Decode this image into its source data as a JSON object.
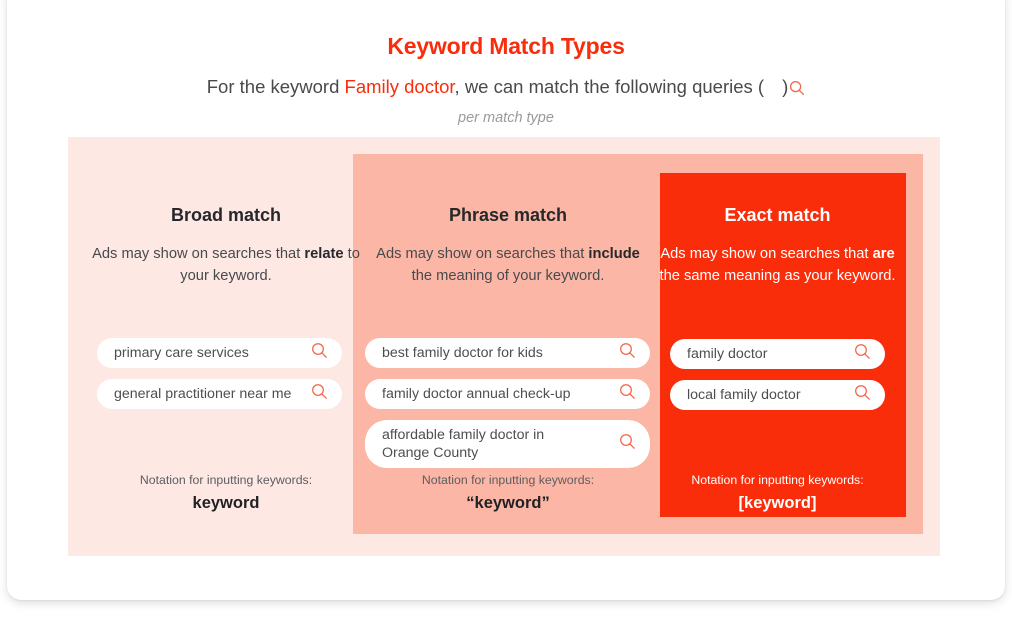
{
  "header": {
    "title": "Keyword Match Types",
    "subtitle_prefix": "For the keyword",
    "subtitle_keyword": "Family doctor",
    "subtitle_middle": ", we can match the following queries (",
    "subtitle_suffix": ")",
    "subtitle_search_icon": "search-icon",
    "sub_note": "per match type",
    "accent_color": "#f92c0c"
  },
  "columns": [
    {
      "key": "broad",
      "heading": "Broad match",
      "desc_before": "Ads may show on searches that ",
      "desc_bold": "relate",
      "desc_after": " to your keyword.",
      "bg_color": "#fee8e4",
      "queries": [
        "primary care services",
        "general practitioner near me"
      ],
      "notation_label": "Notation for inputting keywords:",
      "notation_value": "keyword"
    },
    {
      "key": "phrase",
      "heading": "Phrase match",
      "desc_before": "Ads may show on searches that ",
      "desc_bold": "include",
      "desc_after": " the meaning of your keyword.",
      "bg_color": "#fcb6a5",
      "queries": [
        "best family doctor for kids",
        "family doctor annual check-up",
        "affordable family doctor in Orange County"
      ],
      "notation_label": "Notation for inputting keywords:",
      "notation_value": "“keyword”"
    },
    {
      "key": "exact",
      "heading": "Exact match",
      "desc_before": "Ads may show on searches that ",
      "desc_bold": "are",
      "desc_after": " the same meaning as your keyword.",
      "bg_color": "#fa2d0b",
      "queries": [
        "family doctor",
        "local family doctor"
      ],
      "notation_label": "Notation for inputting keywords:",
      "notation_value": "[keyword]"
    }
  ],
  "icons": {
    "pill_search": "search-icon"
  }
}
